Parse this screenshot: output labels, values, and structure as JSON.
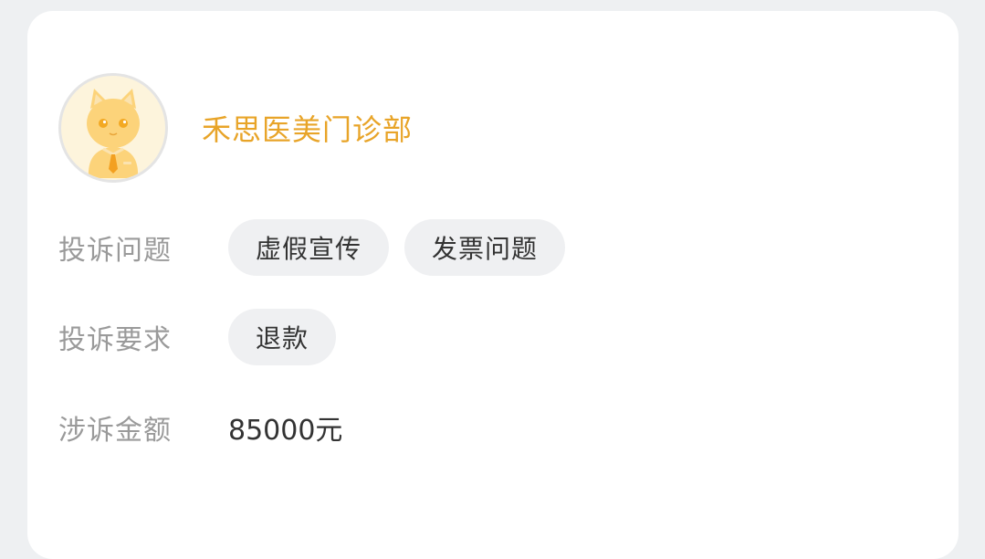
{
  "merchant": {
    "name": "禾思医美门诊部",
    "avatar_icon": "cat-mascot-icon"
  },
  "complaint": {
    "issues_label": "投诉问题",
    "issues": [
      "虚假宣传",
      "发票问题"
    ],
    "requirements_label": "投诉要求",
    "requirements": [
      "退款"
    ],
    "amount_label": "涉诉金额",
    "amount": "85000元"
  },
  "colors": {
    "accent": "#e8a428",
    "background": "#eef0f2",
    "card": "#ffffff",
    "tag_bg": "#eff0f2",
    "label": "#9a9a9a",
    "text": "#333333"
  }
}
